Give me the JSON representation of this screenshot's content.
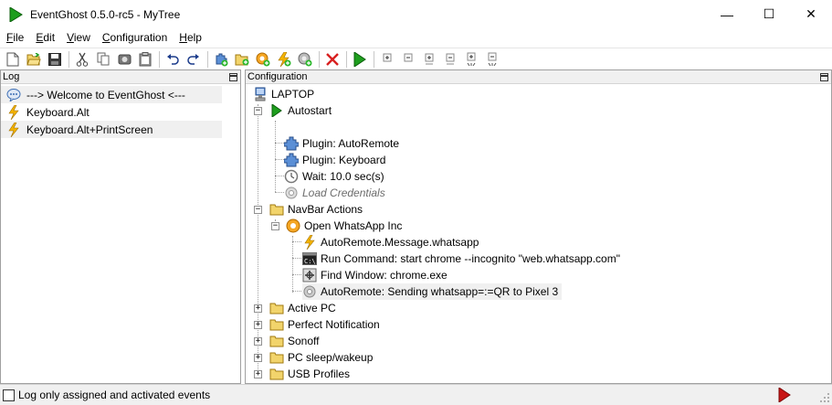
{
  "window": {
    "title": "EventGhost 0.5.0-rc5 - MyTree",
    "minimize": "—",
    "maximize": "☐",
    "close": "✕"
  },
  "menu": [
    {
      "label": "File",
      "hotkey": "F",
      "rest": "ile"
    },
    {
      "label": "Edit",
      "hotkey": "E",
      "rest": "dit"
    },
    {
      "label": "View",
      "hotkey": "V",
      "rest": "iew"
    },
    {
      "label": "Configuration",
      "hotkey": "C",
      "rest": "onfiguration"
    },
    {
      "label": "Help",
      "hotkey": "H",
      "rest": "elp"
    }
  ],
  "toolbar": {
    "buttons": [
      "new-file",
      "open-folder",
      "save",
      "cut",
      "copy",
      "python",
      "paste",
      "undo",
      "redo",
      "add-plugin",
      "add-folder",
      "add-macro",
      "add-event",
      "add-action",
      "delete",
      "execute",
      "expand",
      "collapse",
      "expand-children",
      "collapse-children",
      "expand-all",
      "collapse-all"
    ]
  },
  "log": {
    "header": "Log",
    "items": [
      {
        "text": "---> Welcome to EventGhost <---",
        "icon": "info-icon",
        "selected": true
      },
      {
        "text": "Keyboard.Alt",
        "icon": "lightning-icon",
        "selected": false
      },
      {
        "text": "Keyboard.Alt+PrintScreen",
        "icon": "lightning-icon",
        "selected": true
      }
    ]
  },
  "config": {
    "header": "Configuration",
    "tree": {
      "root": "LAPTOP",
      "autostart": "Autostart",
      "plugin_autoremote": "Plugin: AutoRemote",
      "plugin_keyboard": "Plugin: Keyboard",
      "wait": "Wait: 10.0 sec(s)",
      "load_credentials": "Load Credentials",
      "navbar": "NavBar Actions",
      "open_whatsapp": "Open WhatsApp Inc",
      "event_whatsapp": "AutoRemote.Message.whatsapp",
      "run_command": "Run Command: start chrome --incognito \"web.whatsapp.com\"",
      "find_window": "Find Window: chrome.exe",
      "autoremote_send": "AutoRemote: Sending whatsapp=:=QR to Pixel 3",
      "active_pc": "Active PC",
      "perfect_notification": "Perfect Notification",
      "sonoff": "Sonoff",
      "pc_sleep": "PC sleep/wakeup",
      "usb_profiles": "USB Profiles"
    }
  },
  "status": {
    "checkbox_label": "Log only assigned and activated events",
    "checked": false
  },
  "colors": {
    "accent_green": "#1e9e1e",
    "folder_yellow": "#f2d46b",
    "lightning": "#f5b400",
    "delete_red": "#d82020",
    "status_play_red": "#c81414"
  }
}
